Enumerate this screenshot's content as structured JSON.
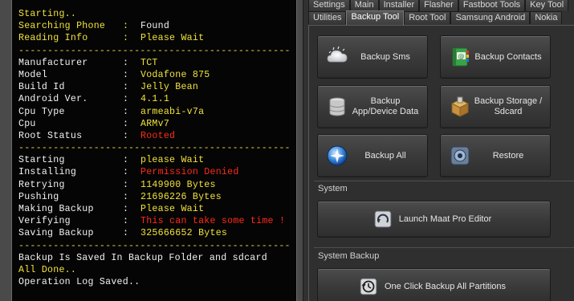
{
  "console": {
    "sep": "-----------------------------------------------",
    "lines": [
      {
        "type": "single",
        "text": "Starting..",
        "color": "yellow"
      },
      {
        "type": "kv",
        "key": "Searching Phone",
        "value": "Found",
        "keyColor": "yellow",
        "valueColor": "white"
      },
      {
        "type": "kv",
        "key": "Reading Info",
        "value": "Please Wait",
        "keyColor": "yellow",
        "valueColor": "yellow"
      },
      {
        "type": "sep"
      },
      {
        "type": "kv",
        "key": "Manufacturer",
        "value": "TCT",
        "keyColor": "white",
        "valueColor": "yellow"
      },
      {
        "type": "kv",
        "key": "Model",
        "value": "Vodafone 875",
        "keyColor": "white",
        "valueColor": "yellow"
      },
      {
        "type": "kv",
        "key": "Build Id",
        "value": "Jelly Bean",
        "keyColor": "white",
        "valueColor": "yellow"
      },
      {
        "type": "kv",
        "key": "Android Ver.",
        "value": "4.1.1",
        "keyColor": "white",
        "valueColor": "yellow"
      },
      {
        "type": "kv",
        "key": "Cpu Type",
        "value": "armeabi-v7a",
        "keyColor": "white",
        "valueColor": "yellow"
      },
      {
        "type": "kv",
        "key": "Cpu",
        "value": "ARMv7",
        "keyColor": "white",
        "valueColor": "yellow"
      },
      {
        "type": "kv",
        "key": "Root Status",
        "value": "Rooted",
        "keyColor": "white",
        "valueColor": "red"
      },
      {
        "type": "sep"
      },
      {
        "type": "kv",
        "key": "Starting",
        "value": "please Wait",
        "keyColor": "white",
        "valueColor": "yellow"
      },
      {
        "type": "kv",
        "key": "Installing",
        "value": "Permission Denied",
        "keyColor": "white",
        "valueColor": "red"
      },
      {
        "type": "kv",
        "key": "Retrying",
        "value": "1149900 Bytes",
        "keyColor": "white",
        "valueColor": "yellow"
      },
      {
        "type": "kv",
        "key": "Pushing",
        "value": "21696226 Bytes",
        "keyColor": "white",
        "valueColor": "yellow"
      },
      {
        "type": "kv",
        "key": "Making Backup",
        "value": "Please Wait",
        "keyColor": "white",
        "valueColor": "yellow"
      },
      {
        "type": "kv",
        "key": "Verifying",
        "value": "This can take some time !",
        "keyColor": "white",
        "valueColor": "red"
      },
      {
        "type": "kv",
        "key": "Saving Backup",
        "value": "325666652 Bytes",
        "keyColor": "white",
        "valueColor": "yellow"
      },
      {
        "type": "sep"
      },
      {
        "type": "single",
        "text": "Backup Is Saved In Backup Folder and sdcard",
        "color": "white"
      },
      {
        "type": "single",
        "text": "All Done..",
        "color": "yellow"
      },
      {
        "type": "single",
        "text": "Operation Log Saved..",
        "color": "white"
      }
    ]
  },
  "tabs": {
    "row1": [
      {
        "label": "Settings"
      },
      {
        "label": "Main"
      },
      {
        "label": "Installer"
      },
      {
        "label": "Flasher"
      },
      {
        "label": "Fastboot Tools"
      },
      {
        "label": "Key Tool"
      }
    ],
    "row2": [
      {
        "label": "Utilities"
      },
      {
        "label": "Backup Tool",
        "active": true
      },
      {
        "label": "Root Tool"
      },
      {
        "label": "Samsung Android"
      },
      {
        "label": "Nokia"
      }
    ]
  },
  "buttons": {
    "backup_sms": {
      "label": "Backup Sms",
      "icon": "sms-cloud-icon"
    },
    "backup_contacts": {
      "label": "Backup Contacts",
      "icon": "contacts-book-icon"
    },
    "backup_app_data": {
      "label": "Backup App/Device Data",
      "icon": "database-icon"
    },
    "backup_storage": {
      "label": "Backup Storage / Sdcard",
      "icon": "storage-box-icon"
    },
    "backup_all": {
      "label": "Backup All",
      "icon": "backup-all-icon"
    },
    "restore": {
      "label": "Restore",
      "icon": "restore-icon"
    },
    "launch_maat": {
      "label": "Launch Maat Pro Editor",
      "icon": "editor-icon"
    },
    "one_click": {
      "label": "One Click Backup All Partitions",
      "icon": "history-clock-icon"
    }
  },
  "sections": {
    "system": "System",
    "system_backup": "System Backup"
  },
  "colors": {
    "yellow": "#f0e23c",
    "white": "#f2f2f2",
    "red": "#ff2a1a",
    "separator": "#e6d84a"
  }
}
